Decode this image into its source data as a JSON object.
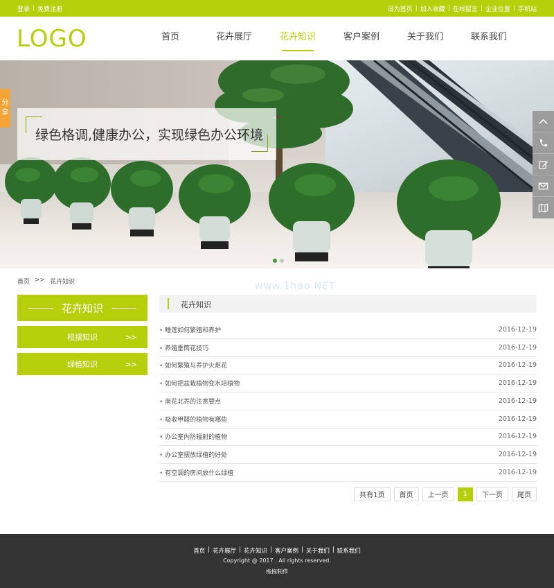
{
  "topbar": {
    "left": [
      "登录",
      "免费注册"
    ],
    "right": [
      "设为首页",
      "加入收藏",
      "在线留言",
      "企业位置",
      "手机站"
    ]
  },
  "logo": "LOGO",
  "nav": [
    {
      "label": "首页",
      "active": false
    },
    {
      "label": "花卉展厅",
      "active": false
    },
    {
      "label": "花卉知识",
      "active": true
    },
    {
      "label": "客户案例",
      "active": false
    },
    {
      "label": "关于我们",
      "active": false
    },
    {
      "label": "联系我们",
      "active": false
    }
  ],
  "banner": {
    "slogan": "绿色格调,健康办公，实现绿色办公环境",
    "slide_count": 2,
    "active_slide": 1
  },
  "share": {
    "chars": [
      "分",
      "享"
    ]
  },
  "side_tools": [
    "chevron-up-icon",
    "phone-icon",
    "edit-icon",
    "mail-icon",
    "map-icon"
  ],
  "breadcrumb": {
    "home": "首页",
    "sep": ">>",
    "current": "花卉知识"
  },
  "sidebar": {
    "title": "花卉知识",
    "items": [
      {
        "label": "租摆知识",
        "arrow": ">>"
      },
      {
        "label": "绿植知识",
        "arrow": ">>"
      }
    ]
  },
  "watermark": "www.1hao.NET",
  "content": {
    "title": "花卉知识",
    "articles": [
      {
        "title": "睡莲如何繁殖和养护",
        "date": "2016-12-19"
      },
      {
        "title": "养殖垂筒花技巧",
        "date": "2016-12-19"
      },
      {
        "title": "如何繁殖与养护火炬花",
        "date": "2016-12-19"
      },
      {
        "title": "如何把盆栽植物变水培植物",
        "date": "2016-12-19"
      },
      {
        "title": "南花北养的注意要点",
        "date": "2016-12-19"
      },
      {
        "title": "吸收甲醛的植物有哪些",
        "date": "2016-12-19"
      },
      {
        "title": "办公室内防辐射的植物",
        "date": "2016-12-19"
      },
      {
        "title": "办公室摆放绿植的好处",
        "date": "2016-12-19"
      },
      {
        "title": "有空调的房间放什么绿植",
        "date": "2016-12-19"
      }
    ]
  },
  "pager": {
    "total": "共有1页",
    "first": "首页",
    "prev": "上一页",
    "current": "1",
    "next": "下一页",
    "last": "尾页"
  },
  "footer": {
    "links": [
      "首页",
      "花卉展厅",
      "花卉知识",
      "客户案例",
      "关于我们",
      "联系我们"
    ],
    "copyright": "Copyright @ 2017 . All rights reserved.",
    "maker": "拖拖制作"
  },
  "colors": {
    "accent": "#b5cf0a",
    "share": "#f5a43a",
    "footer_bg": "#333333",
    "tool_bg": "#9c9c9c"
  }
}
